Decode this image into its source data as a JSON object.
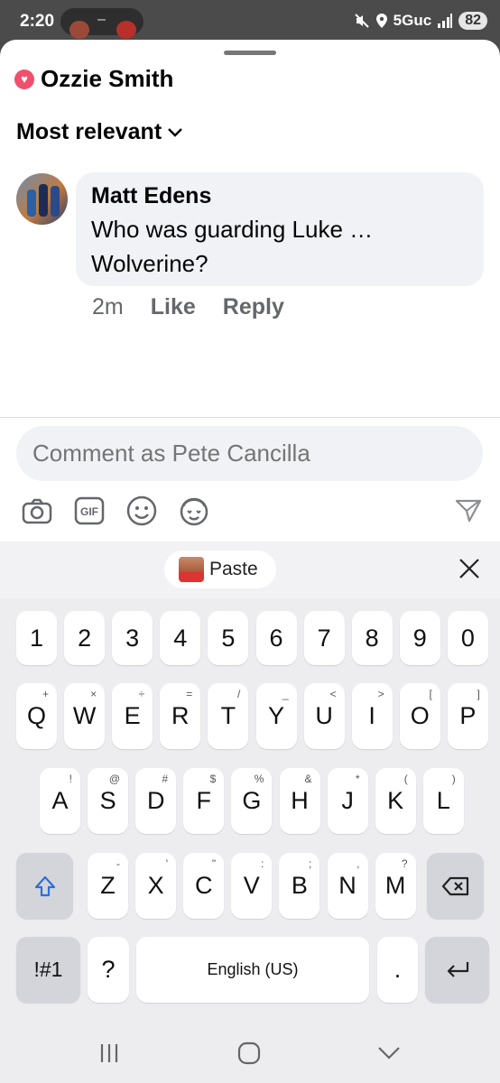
{
  "status_bar": {
    "time": "2:20",
    "network": "5Guc",
    "battery": "82"
  },
  "header": {
    "page_name": "Ozzie Smith"
  },
  "sort": {
    "label": "Most relevant"
  },
  "comment": {
    "author": "Matt Edens",
    "text": "Who was guarding Luke … Wolverine?",
    "time": "2m",
    "like_label": "Like",
    "reply_label": "Reply"
  },
  "composer": {
    "placeholder": "Comment as Pete Cancilla"
  },
  "clipboard": {
    "paste_label": "Paste"
  },
  "keyboard": {
    "numbers": [
      "1",
      "2",
      "3",
      "4",
      "5",
      "6",
      "7",
      "8",
      "9",
      "0"
    ],
    "row1": [
      {
        "k": "Q",
        "s": "+"
      },
      {
        "k": "W",
        "s": "×"
      },
      {
        "k": "E",
        "s": "÷"
      },
      {
        "k": "R",
        "s": "="
      },
      {
        "k": "T",
        "s": "/"
      },
      {
        "k": "Y",
        "s": "_"
      },
      {
        "k": "U",
        "s": "<"
      },
      {
        "k": "I",
        "s": ">"
      },
      {
        "k": "O",
        "s": "["
      },
      {
        "k": "P",
        "s": "]"
      }
    ],
    "row2": [
      {
        "k": "A",
        "s": "!"
      },
      {
        "k": "S",
        "s": "@"
      },
      {
        "k": "D",
        "s": "#"
      },
      {
        "k": "F",
        "s": "$"
      },
      {
        "k": "G",
        "s": "%"
      },
      {
        "k": "H",
        "s": "&"
      },
      {
        "k": "J",
        "s": "*"
      },
      {
        "k": "K",
        "s": "("
      },
      {
        "k": "L",
        "s": ")"
      }
    ],
    "row3": [
      {
        "k": "Z",
        "s": "-"
      },
      {
        "k": "X",
        "s": "'"
      },
      {
        "k": "C",
        "s": "\""
      },
      {
        "k": "V",
        "s": ":"
      },
      {
        "k": "B",
        "s": ";"
      },
      {
        "k": "N",
        "s": ","
      },
      {
        "k": "M",
        "s": "?"
      }
    ],
    "symbols_label": "!#1",
    "question_label": "?",
    "space_label": "English (US)",
    "period_label": "."
  }
}
